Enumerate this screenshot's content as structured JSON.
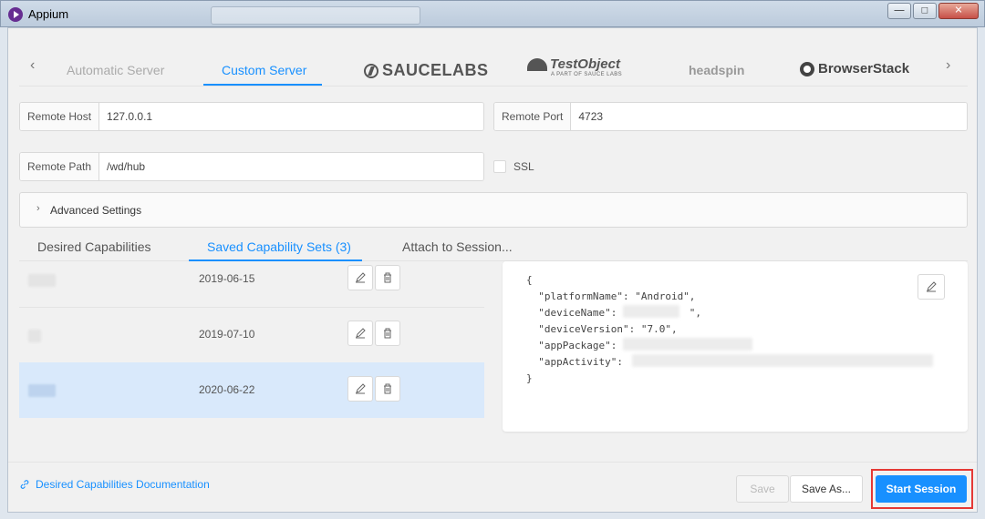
{
  "window": {
    "title": "Appium"
  },
  "server_tabs": {
    "automatic": "Automatic Server",
    "custom": "Custom Server",
    "saucelabs": "SAUCELABS",
    "testobject": "TestObject",
    "testobject_sub": "A PART OF SAUCE LABS",
    "headspin": "headspin",
    "browserstack": "BrowserStack"
  },
  "fields": {
    "remote_host_label": "Remote Host",
    "remote_host_value": "127.0.0.1",
    "remote_port_label": "Remote Port",
    "remote_port_value": "4723",
    "remote_path_label": "Remote Path",
    "remote_path_value": "/wd/hub",
    "ssl_label": "SSL"
  },
  "advanced": {
    "label": "Advanced Settings"
  },
  "cap_tabs": {
    "desired": "Desired Capabilities",
    "saved": "Saved Capability Sets (3)",
    "attach": "Attach to Session..."
  },
  "saved_sets": [
    {
      "date": "2019-06-15",
      "selected": false
    },
    {
      "date": "2019-07-10",
      "selected": false
    },
    {
      "date": "2020-06-22",
      "selected": true
    }
  ],
  "json_view": {
    "lines": [
      "{",
      "  \"platformName\": \"Android\",",
      "  \"deviceName\":            \",",
      "  \"deviceVersion\": \"7.0\",",
      "  \"appPackage\":",
      "  \"appActivity\":",
      "}"
    ]
  },
  "footer": {
    "doc_link": "Desired Capabilities Documentation",
    "save": "Save",
    "save_as": "Save As...",
    "start": "Start Session"
  },
  "colors": {
    "accent": "#1890ff",
    "selected_row": "#d9e9fb",
    "highlight_outline": "#e53935"
  }
}
